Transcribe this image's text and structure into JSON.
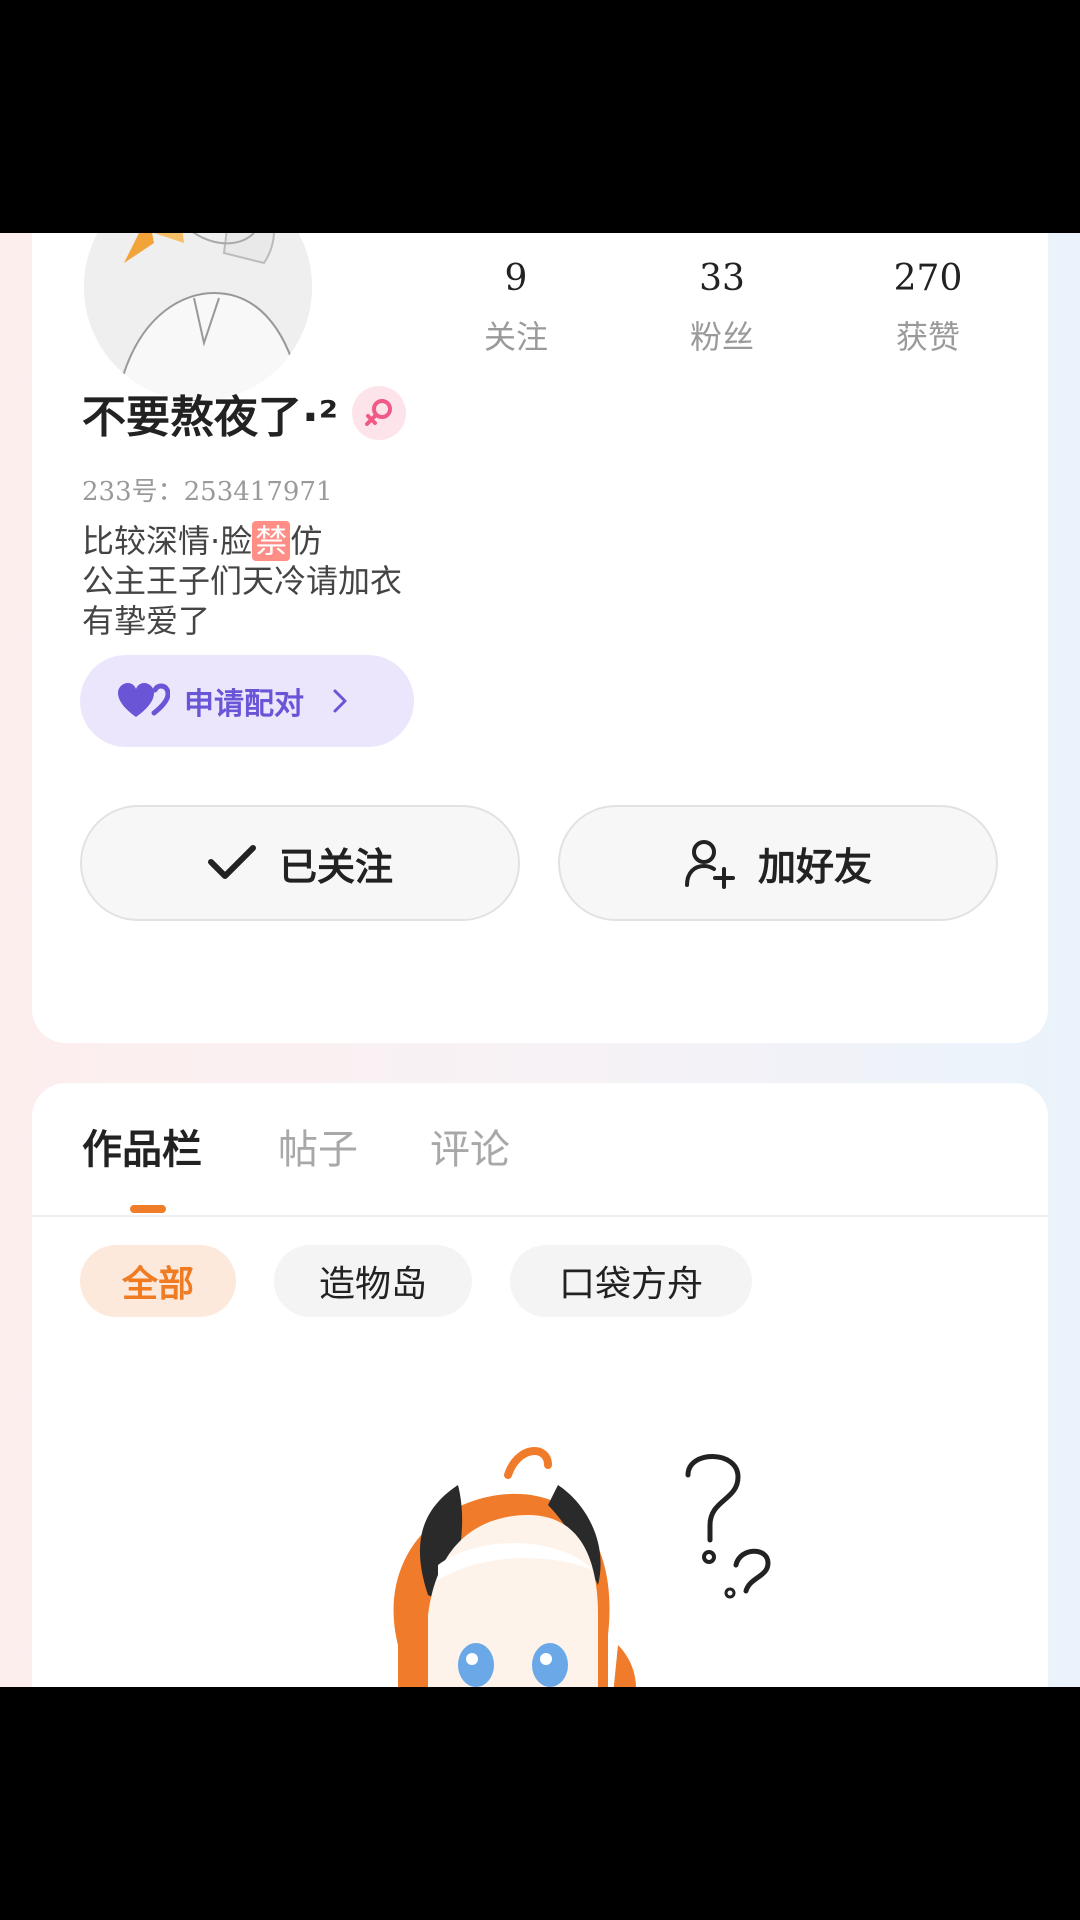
{
  "profile": {
    "stats": [
      {
        "value": "9",
        "label": "关注"
      },
      {
        "value": "33",
        "label": "粉丝"
      },
      {
        "value": "270",
        "label": "获赞"
      }
    ],
    "name": "不要熬夜了·²",
    "uid_label": "233号：",
    "uid": "253417971",
    "bio": {
      "line1_before": "比较深情·脸",
      "line1_badge": "禁",
      "line1_after": "仿",
      "line2": "公主王子们天冷请加衣",
      "line3": "有挚爱了"
    },
    "pair_button": "申请配对",
    "follow_button": "已关注",
    "add_friend_button": "加好友"
  },
  "works": {
    "tabs": [
      "作品栏",
      "帖子",
      "评论"
    ],
    "active_tab": 0,
    "filters": [
      "全部",
      "造物岛",
      "口袋方舟"
    ],
    "active_filter": 0
  },
  "colors": {
    "accent_orange": "#ef7b22",
    "pair_purple": "#6a55d6",
    "gender_pink": "#ef5a86"
  }
}
